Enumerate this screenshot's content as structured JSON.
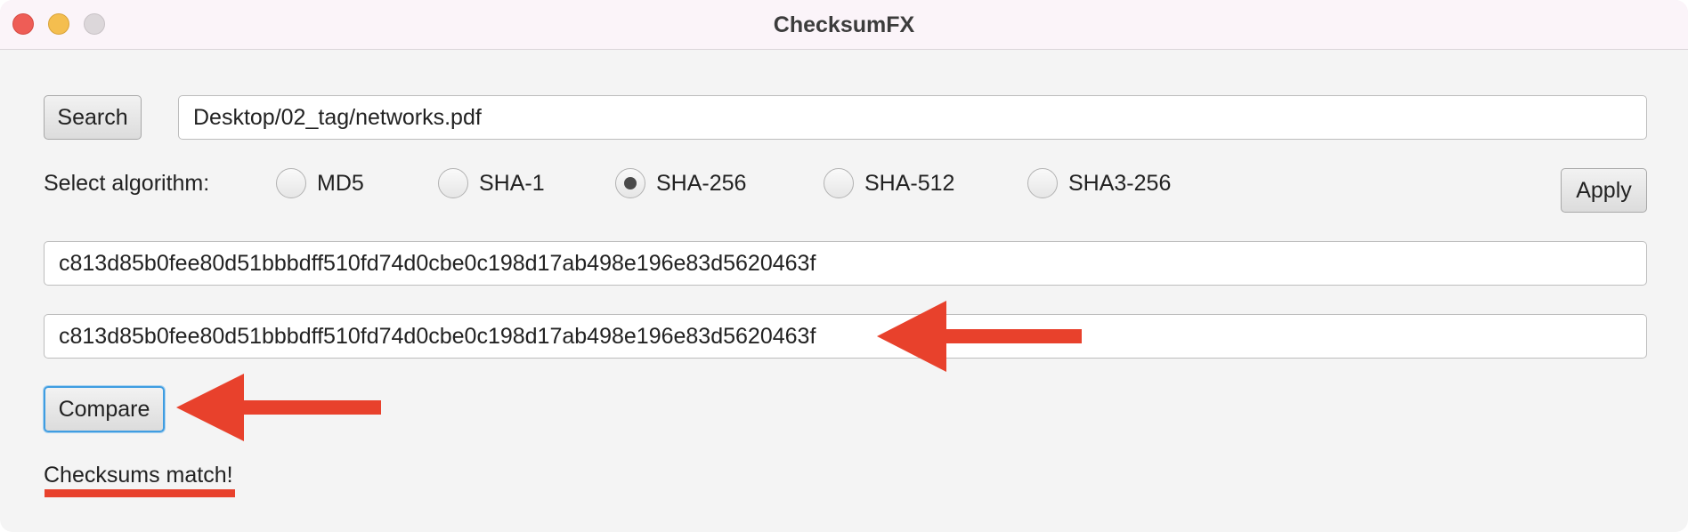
{
  "window": {
    "title": "ChecksumFX"
  },
  "file": {
    "search_label": "Search",
    "path": "Desktop/02_tag/networks.pdf"
  },
  "algorithm": {
    "label": "Select algorithm:",
    "options": [
      "MD5",
      "SHA-1",
      "SHA-256",
      "SHA-512",
      "SHA3-256"
    ],
    "selected": "SHA-256",
    "apply_label": "Apply"
  },
  "hashes": {
    "computed": "c813d85b0fee80d51bbbdff510fd74d0cbe0c198d17ab498e196e83d5620463f",
    "expected": "c813d85b0fee80d51bbbdff510fd74d0cbe0c198d17ab498e196e83d5620463f"
  },
  "compare": {
    "label": "Compare",
    "result": "Checksums match!"
  },
  "colors": {
    "annotation": "#e8412c",
    "focus": "#3f9de1"
  }
}
